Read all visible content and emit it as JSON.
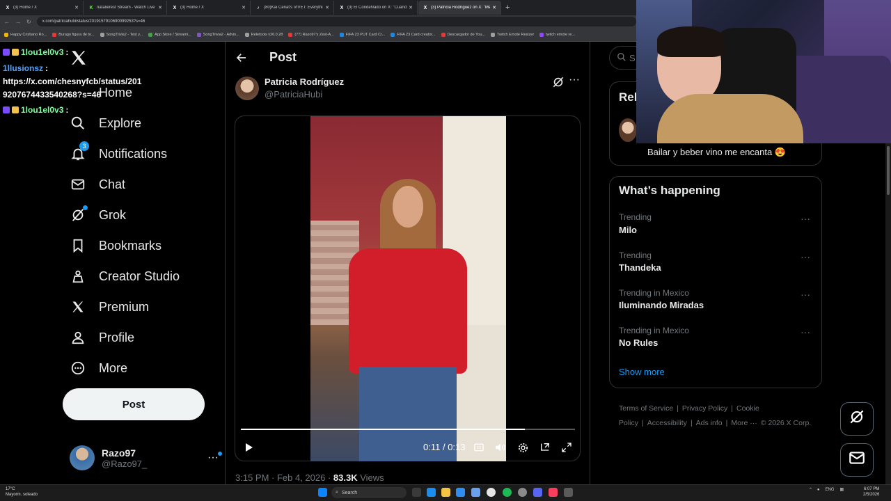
{
  "browser": {
    "tabs": [
      {
        "title": "(3) Home / X",
        "icon": "x-logo-icon",
        "color": "#ffffff"
      },
      {
        "title": "natalierest Stream - Watch Live",
        "icon": "kick-icon",
        "color": "#53fc18"
      },
      {
        "title": "(3) Home / X",
        "icon": "x-logo-icon",
        "color": "#ffffff"
      },
      {
        "title": "(80)Kai Cenat's VIVET: Everything",
        "icon": "tiktok-icon",
        "color": "#ffffff"
      },
      {
        "title": "(3) El CondeNado on X: \"Cuando",
        "icon": "x-logo-icon",
        "color": "#ffffff"
      },
      {
        "title": "(3) Patricia Rodríguez on X: \"Me",
        "icon": "x-logo-icon",
        "color": "#ffffff",
        "active": true
      }
    ],
    "new_tab": "+",
    "url": "x.com/patriciahubi/status/2019157910690099253?s=46",
    "bookmarks": [
      {
        "label": "Happy Cristiano Ro...",
        "color": "#f4b400"
      },
      {
        "label": "Burago figura de to...",
        "color": "#e53935"
      },
      {
        "label": "SongTrivia2 - Test y...",
        "color": "#9e9e9e"
      },
      {
        "label": "App Store / Streami...",
        "color": "#43a047"
      },
      {
        "label": "SongTrivia2 - Advin...",
        "color": "#7e57c2"
      },
      {
        "label": "Reletools v26.0.28",
        "color": "#9e9e9e"
      },
      {
        "label": "(77) Razo97's Zest-A...",
        "color": "#e53935"
      },
      {
        "label": "FIFA 23 PUT Card Cr...",
        "color": "#1e88e5"
      },
      {
        "label": "FIFA 23 Card creator...",
        "color": "#1e88e5"
      },
      {
        "label": "Descargador de You...",
        "color": "#e53935"
      },
      {
        "label": "Twitch Emote Resizer",
        "color": "#9e9e9e"
      },
      {
        "label": "twitch emote re...",
        "color": "#9146ff"
      }
    ]
  },
  "chat": [
    {
      "user": "1lou1el0v3",
      "color": "#7fffa0",
      "text": ":"
    },
    {
      "user": "1llusionsz",
      "color": "#4ea3ff",
      "text": ":"
    },
    {
      "text": "https://x.com/chesnyfcb/status/201"
    },
    {
      "text": "9207674433540268?s=46"
    },
    {
      "user": "1lou1el0v3",
      "color": "#7fffa0",
      "text": ":"
    }
  ],
  "nav": {
    "items": [
      {
        "label": "Home",
        "icon": "home-icon"
      },
      {
        "label": "Explore",
        "icon": "search-icon"
      },
      {
        "label": "Notifications",
        "icon": "bell-icon",
        "badge": "3"
      },
      {
        "label": "Chat",
        "icon": "mail-icon"
      },
      {
        "label": "Grok",
        "icon": "grok-icon"
      },
      {
        "label": "Bookmarks",
        "icon": "bookmark-icon"
      },
      {
        "label": "Creator Studio",
        "icon": "creator-studio-icon"
      },
      {
        "label": "Premium",
        "icon": "x-logo-icon"
      },
      {
        "label": "Profile",
        "icon": "person-icon"
      },
      {
        "label": "More",
        "icon": "more-circle-icon"
      }
    ],
    "post_button": "Post",
    "account": {
      "name": "Razo97",
      "handle": "@Razo97_"
    }
  },
  "post": {
    "header": "Post",
    "author_name": "Patricia Rodríguez",
    "author_handle": "@PatriciaHubi",
    "video": {
      "current_time": "0:11",
      "duration": "0:13",
      "progress_fraction": 0.85
    },
    "timestamp": "3:15 PM · Feb 4, 2026 · ",
    "views_count": "83.3K",
    "views_label": " Views"
  },
  "right": {
    "search_placeholder": "S",
    "relevant_title": "Rel",
    "relevant_text": "Bailar y beber vino me encanta 😍",
    "happening_title": "What’s happening",
    "trends": [
      {
        "context": "Trending",
        "name": "Milo"
      },
      {
        "context": "Trending",
        "name": "Thandeka"
      },
      {
        "context": "Trending in Mexico",
        "name": "Iluminando Miradas"
      },
      {
        "context": "Trending in Mexico",
        "name": "No Rules"
      }
    ],
    "show_more": "Show more",
    "footer": [
      "Terms of Service",
      "|",
      "Privacy Policy",
      "|",
      "Cookie Policy",
      "|",
      "Accessibility",
      "|",
      "Ads info",
      "|",
      "More ···",
      "© 2026 X Corp."
    ]
  },
  "taskbar": {
    "weather_temp": "17°C",
    "weather_desc": "Mayorm. soleado",
    "search_label": "Search",
    "tray_lang": "ENG",
    "time": "6:07 PM",
    "date": "2/5/2026"
  },
  "colors": {
    "accent": "#1d9bf0",
    "background": "#000000",
    "border": "#2f3336",
    "muted": "#71767b"
  }
}
